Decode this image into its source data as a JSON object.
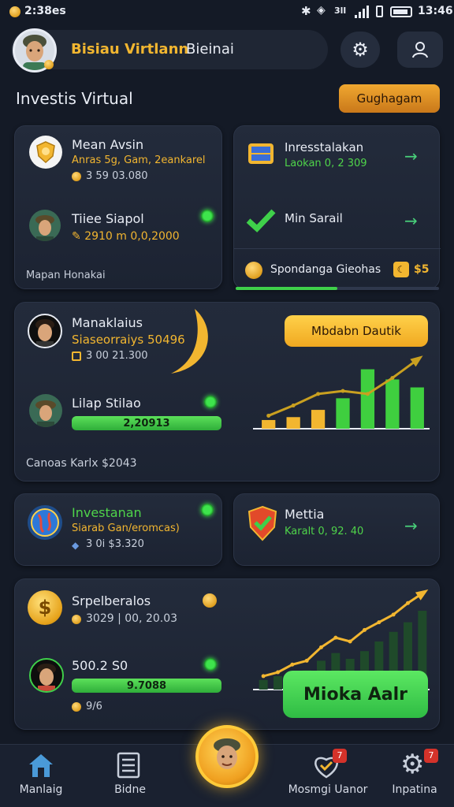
{
  "status": {
    "time_left": "2:38es",
    "clock": "13:46"
  },
  "header": {
    "user_name": "Bisiau Virtlann",
    "user_suffix": "Bieinai"
  },
  "section": {
    "title": "Investis Virtual",
    "action_label": "Gughagam"
  },
  "card1": {
    "row1": {
      "title": "Mean Avsin",
      "subtitle": "Anras 5g, Gam, 2eankarel",
      "value": "3 59 03.080"
    },
    "row2": {
      "title": "Tiiee Siapol",
      "value": "2910 m  0,0,2000"
    },
    "footer": "Mapan Honakai"
  },
  "card2": {
    "row1": {
      "title": "Inresstalakan",
      "subtitle": "Laokan 0, 2 309"
    },
    "row2": {
      "title": "Min Sarail"
    },
    "footer": "Spondanga Gieohas",
    "footer_value": "$5",
    "progress": 0.5
  },
  "card3": {
    "row1": {
      "title": "Manaklaius",
      "subtitle": "Siaseorraiys 50496",
      "value": "3 00 21.300"
    },
    "row2": {
      "title": "Lilap Stilao",
      "bar_value": "2,20913"
    },
    "footer": "Canoas Karlx $2043",
    "chart_label": "Mbdabn Dautik"
  },
  "card4": {
    "title": "Investanan",
    "subtitle": "Siarab Gan/eromcas)",
    "value": "3 0i $3.320"
  },
  "card5": {
    "title": "Mettia",
    "subtitle": "Karalt 0, 92. 40"
  },
  "card6": {
    "row1": {
      "title": "Srpelberalos",
      "value": "3029 | 00, 20.03"
    },
    "row2": {
      "title": "500.2 S0",
      "bar_value": "9.7088",
      "sub_value": "9/6"
    },
    "cta_label": "Mioka Aalr"
  },
  "nav": {
    "items": [
      {
        "label": "Manlaig"
      },
      {
        "label": "Bidne"
      },
      {
        "label": "Mosmgi Uanor"
      },
      {
        "label": "Inpatina"
      }
    ],
    "badge_1": "7",
    "badge_2": "7"
  },
  "chart_data": [
    {
      "type": "bar",
      "title": "",
      "categories": [
        "1",
        "2",
        "3",
        "4",
        "5",
        "6",
        "7"
      ],
      "values": [
        12,
        16,
        26,
        42,
        82,
        68,
        57
      ],
      "trend": [
        18,
        32,
        48,
        52,
        48,
        70,
        95
      ]
    },
    {
      "type": "bar",
      "title": "",
      "categories": [
        "1",
        "2",
        "3",
        "4",
        "5",
        "6",
        "7",
        "8",
        "9",
        "10",
        "11",
        "12"
      ],
      "values": [
        10,
        14,
        18,
        20,
        30,
        38,
        32,
        40,
        50,
        60,
        70,
        82
      ],
      "trend": [
        14,
        18,
        26,
        30,
        44,
        54,
        50,
        62,
        70,
        78,
        90,
        100
      ]
    }
  ],
  "colors": {
    "bg": "#141a26",
    "card": "#212938",
    "gold": "#f2b630",
    "green": "#4fd44a"
  }
}
